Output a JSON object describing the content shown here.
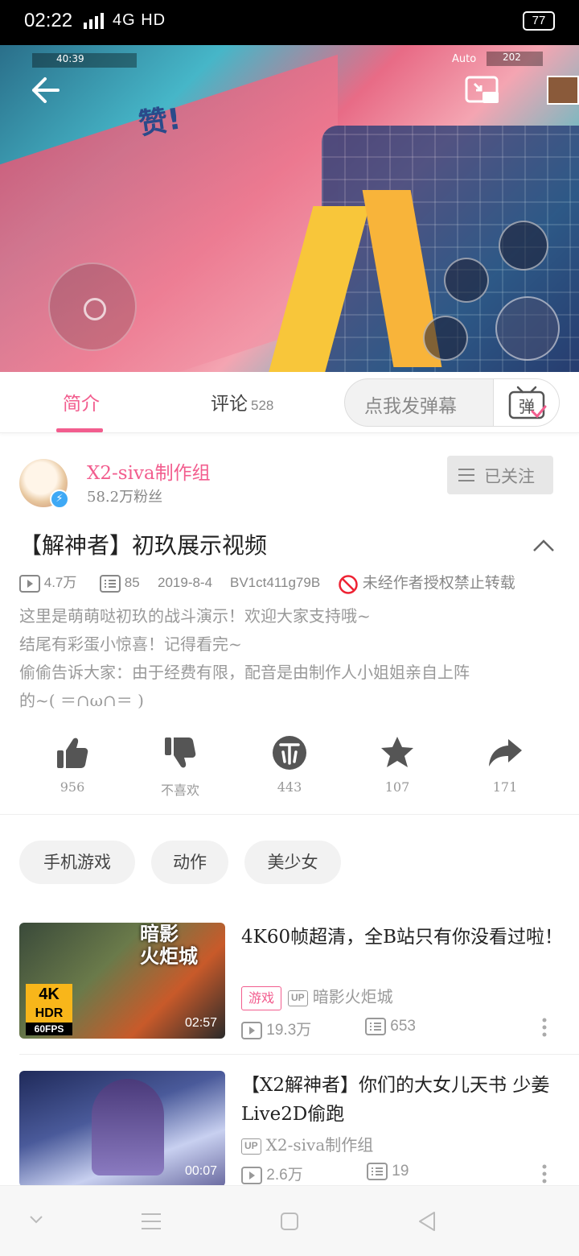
{
  "status_bar": {
    "time": "02:22",
    "network": "4G HD",
    "battery": "77"
  },
  "video_overlay": {
    "praise_text": "赞!",
    "hud_left": "40:39",
    "hud_auto": "Auto",
    "hud_coins": "202"
  },
  "tabs": {
    "intro": "简介",
    "comments": "评论",
    "comment_count": "528"
  },
  "danmaku": {
    "placeholder": "点我发弹幕",
    "button_glyph": "弹"
  },
  "uploader": {
    "name": "X2-siva制作组",
    "fans": "58.2万粉丝",
    "follow_label": "已关注"
  },
  "video": {
    "title": "【解神者】初玖展示视频",
    "plays": "4.7万",
    "danmaku_count": "85",
    "date": "2019-8-4",
    "bvid": "BV1ct411g79B",
    "notice": "未经作者授权禁止转载",
    "description": [
      "这里是萌萌哒初玖的战斗演示！欢迎大家支持哦~",
      "结尾有彩蛋小惊喜！记得看完~",
      "偷偷告诉大家：由于经费有限，配音是由制作人小姐姐亲自上阵",
      "的~( ＝∩ω∩＝ )"
    ]
  },
  "actions": [
    {
      "name": "like",
      "label": "956"
    },
    {
      "name": "dislike",
      "label": "不喜欢"
    },
    {
      "name": "coin",
      "label": "443"
    },
    {
      "name": "favorite",
      "label": "107"
    },
    {
      "name": "share",
      "label": "171"
    }
  ],
  "tags": [
    "手机游戏",
    "动作",
    "美少女"
  ],
  "related": [
    {
      "title": "4K60帧超清，全B站只有你没看过啦！",
      "category": "游戏",
      "up_badge": "UP",
      "uploader": "暗影火炬城",
      "plays": "19.3万",
      "danmaku": "653",
      "duration": "02:57",
      "thumb_text": "暗影\n火炬城",
      "badge_4k": "4K",
      "badge_hdr": "HDR",
      "badge_fps": "60FPS"
    },
    {
      "title": "【X2解神者】你们的大女儿天书 少姜Live2D偷跑",
      "up_badge": "UP",
      "uploader": "X2-siva制作组",
      "plays": "2.6万",
      "danmaku": "19",
      "duration": "00:07"
    }
  ],
  "colors": {
    "accent": "#f25d8e",
    "grey_text": "#999999",
    "tag_bg": "#f2f2f2"
  }
}
